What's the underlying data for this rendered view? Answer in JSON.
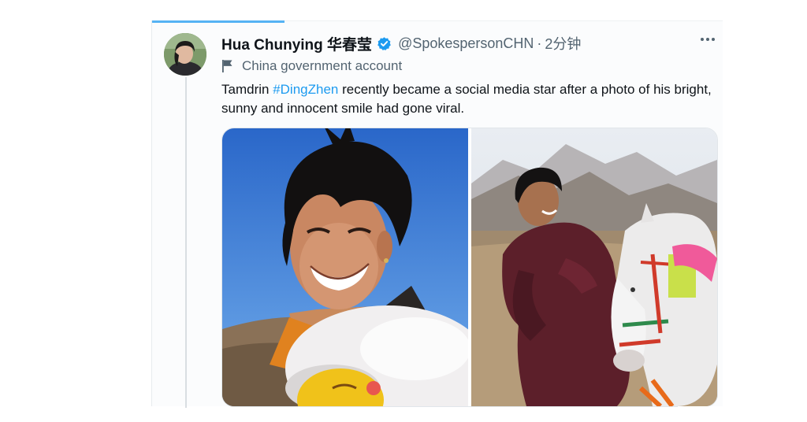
{
  "tweet": {
    "display_name": "Hua Chunying 华春莹",
    "handle": "@SpokespersonCHN",
    "separator": "·",
    "time": "2分钟",
    "account_label": "China government account",
    "text_before": "Tamdrin ",
    "hashtag": "#DingZhen",
    "text_after": " recently became a social media star after a photo of his bright, sunny and innocent smile had gone viral.",
    "icons": {
      "verified": "verified-badge-icon",
      "flag": "flag-icon",
      "more": "more-options-icon"
    },
    "colors": {
      "link_blue": "#1d9bf0",
      "text_primary": "#0f1419",
      "text_secondary": "#536471"
    },
    "media_count": 2
  }
}
